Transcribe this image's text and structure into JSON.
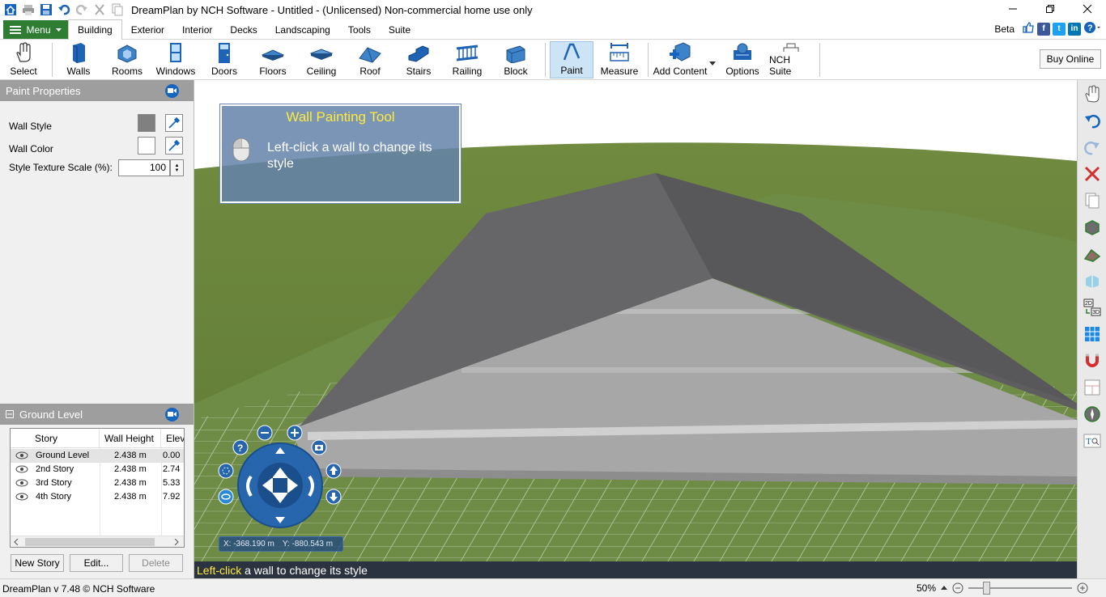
{
  "window": {
    "title": "DreamPlan by NCH Software - Untitled - (Unlicensed) Non-commercial home use only"
  },
  "ribbon": {
    "menu_label": "Menu",
    "tabs": [
      "Building",
      "Exterior",
      "Interior",
      "Decks",
      "Landscaping",
      "Tools",
      "Suite"
    ],
    "active_tab": "Building",
    "beta_label": "Beta"
  },
  "toolbar": {
    "buttons": [
      "Select",
      "Walls",
      "Rooms",
      "Windows",
      "Doors",
      "Floors",
      "Ceiling",
      "Roof",
      "Stairs",
      "Railing",
      "Block",
      "Paint",
      "Measure",
      "Add Content",
      "Options",
      "NCH Suite"
    ],
    "active_button": "Paint",
    "buy_online_label": "Buy Online"
  },
  "paint_properties": {
    "header": "Paint Properties",
    "wall_style_label": "Wall Style",
    "wall_color_label": "Wall Color",
    "texture_scale_label": "Style Texture Scale (%):",
    "texture_scale_value": "100",
    "wall_style_swatch_color": "#808080",
    "wall_color_swatch_color": "#ffffff"
  },
  "stories": {
    "header": "Ground Level",
    "columns": [
      "Story",
      "Wall Height",
      "Eleva"
    ],
    "rows": [
      {
        "name": "Ground Level",
        "wall_height": "2.438 m",
        "elevation": "0.00",
        "selected": true
      },
      {
        "name": "2nd Story",
        "wall_height": "2.438 m",
        "elevation": "2.74",
        "selected": false
      },
      {
        "name": "3rd Story",
        "wall_height": "2.438 m",
        "elevation": "5.33",
        "selected": false
      },
      {
        "name": "4th Story",
        "wall_height": "2.438 m",
        "elevation": "7.92",
        "selected": false
      }
    ],
    "new_story_label": "New Story",
    "edit_label": "Edit...",
    "delete_label": "Delete"
  },
  "viewport": {
    "tooltip_title": "Wall Painting Tool",
    "tooltip_text": "Left-click a wall to change its style",
    "coord_x": "X: -368.190 m",
    "coord_y": "Y: -880.543 m"
  },
  "hint": {
    "highlight": "Left-click",
    "text": " a wall to change its style"
  },
  "status": {
    "version": "DreamPlan v 7.48 © NCH Software",
    "zoom": "50%",
    "zoom_fraction": 0.15
  },
  "colors": {
    "menu_green": "#2e7d32",
    "accent_blue": "#1565c0",
    "grass": "#6e8f3a",
    "roof": "#5f5f60",
    "wall": "#a6a6a6"
  }
}
